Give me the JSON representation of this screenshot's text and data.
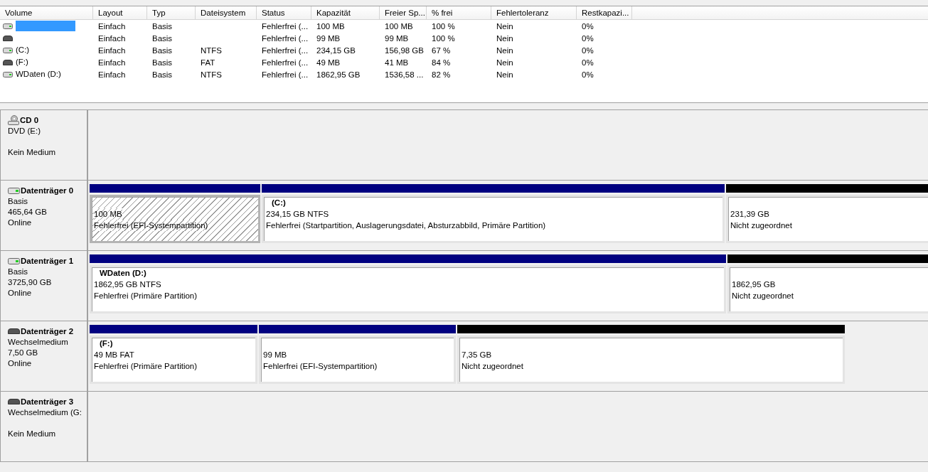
{
  "volume_table": {
    "columns": [
      "Volume",
      "Layout",
      "Typ",
      "Dateisystem",
      "Status",
      "Kapazität",
      "Freier Sp...",
      "% frei",
      "Fehlertoleranz",
      "Restkapazi..."
    ],
    "rows": [
      {
        "kind": "hdd",
        "selected": true,
        "cells": [
          "",
          "Einfach",
          "Basis",
          "",
          "Fehlerfrei (...",
          "100 MB",
          "100 MB",
          "100 %",
          "Nein",
          "0%"
        ]
      },
      {
        "kind": "removable",
        "selected": false,
        "cells": [
          "",
          "Einfach",
          "Basis",
          "",
          "Fehlerfrei (...",
          "99 MB",
          "99 MB",
          "100 %",
          "Nein",
          "0%"
        ]
      },
      {
        "kind": "hdd",
        "selected": false,
        "cells": [
          "(C:)",
          "Einfach",
          "Basis",
          "NTFS",
          "Fehlerfrei (...",
          "234,15 GB",
          "156,98 GB",
          "67 %",
          "Nein",
          "0%"
        ]
      },
      {
        "kind": "removable",
        "selected": false,
        "cells": [
          "(F:)",
          "Einfach",
          "Basis",
          "FAT",
          "Fehlerfrei (...",
          "49 MB",
          "41 MB",
          "84 %",
          "Nein",
          "0%"
        ]
      },
      {
        "kind": "hdd",
        "selected": false,
        "cells": [
          "WDaten (D:)",
          "Einfach",
          "Basis",
          "NTFS",
          "Fehlerfrei (...",
          "1862,95 GB",
          "1536,58 ...",
          "82 %",
          "Nein",
          "0%"
        ]
      }
    ]
  },
  "disks": [
    {
      "kind": "cd",
      "name": "CD 0",
      "type": "DVD (E:)",
      "state": "Kein Medium"
    },
    {
      "kind": "hdd",
      "name": "Datenträger 0",
      "type": "Basis",
      "size": "465,64 GB",
      "state": "Online",
      "partitions": [
        {
          "kind": "primary",
          "selected": true,
          "size": "100 MB",
          "status": "Fehlerfrei (EFI-Systempartition)"
        },
        {
          "kind": "primary",
          "selected": false,
          "title": "(C:)",
          "size": "234,15 GB NTFS",
          "status": "Fehlerfrei (Startpartition, Auslagerungsdatei, Absturzabbild, Primäre Partition)"
        },
        {
          "kind": "unallocated",
          "selected": false,
          "size": "231,39 GB",
          "status": "Nicht zugeordnet"
        }
      ]
    },
    {
      "kind": "hdd",
      "name": "Datenträger 1",
      "type": "Basis",
      "size": "3725,90 GB",
      "state": "Online",
      "partitions": [
        {
          "kind": "primary",
          "selected": false,
          "title": "WDaten  (D:)",
          "size": "1862,95 GB NTFS",
          "status": "Fehlerfrei (Primäre Partition)"
        },
        {
          "kind": "unallocated",
          "selected": false,
          "size": "1862,95 GB",
          "status": "Nicht zugeordnet"
        }
      ]
    },
    {
      "kind": "removable",
      "name": "Datenträger 2",
      "type": "Wechselmedium",
      "size": "7,50 GB",
      "state": "Online",
      "partitions": [
        {
          "kind": "primary",
          "selected": false,
          "title": "(F:)",
          "size": "49 MB FAT",
          "status": "Fehlerfrei (Primäre Partition)"
        },
        {
          "kind": "primary",
          "selected": false,
          "size": "99 MB",
          "status": "Fehlerfrei (EFI-Systempartition)"
        },
        {
          "kind": "unallocated",
          "selected": false,
          "size": "7,35 GB",
          "status": "Nicht zugeordnet"
        }
      ]
    },
    {
      "kind": "removable",
      "name": "Datenträger 3",
      "type": "Wechselmedium (G:",
      "state": "Kein Medium"
    }
  ]
}
